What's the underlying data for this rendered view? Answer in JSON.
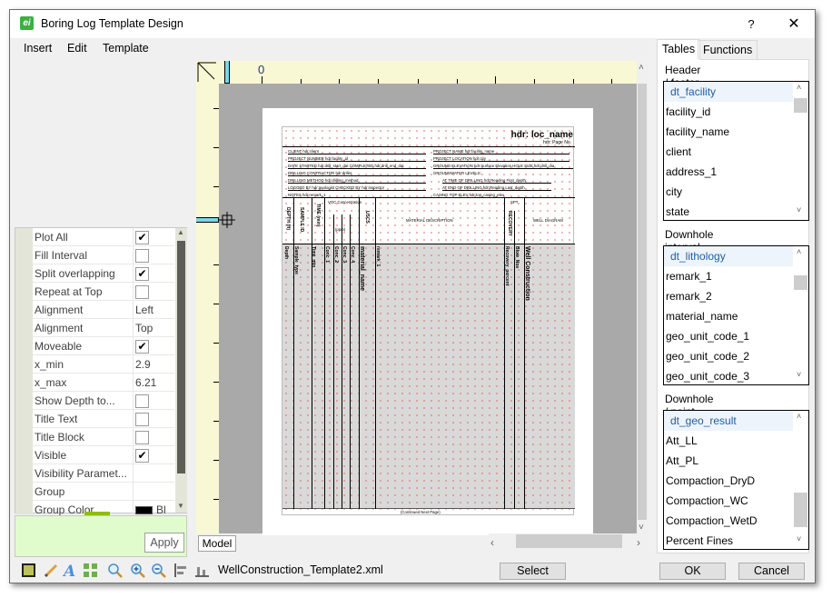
{
  "window": {
    "title": "Boring Log Template Design",
    "help_label": "?",
    "close_label": "✕",
    "app_icon_glyph": "ei"
  },
  "menu": {
    "items": [
      "Insert",
      "Edit",
      "Template"
    ]
  },
  "canvas": {
    "ruler_zero_label": "0",
    "model_tab_label": "Model",
    "template": {
      "header_title": "hdr: loc_name",
      "header_page": "hdr: Page No.",
      "info_left": [
        "CLIENT hdr:client",
        "PROJECT NUMBER hdr:facility_id",
        "DATE STARTED hdr:drill_start_dat  COMPLETED hdr:drill_end_dat",
        "DRILLING CONTRACTOR hdr:driller",
        "DRILLING METHOD hdr:drilling_method",
        "LOGGED BY hdr:geologist   CHECKED BY hdr:inspector",
        "NOTES hdr:remark_1"
      ],
      "info_right": [
        "PROJECT NAME hdr:facility_name",
        "PROJECT LOCATION hdr:city",
        "GROUND ELEVATION hdr:Surface Elevation  HOLE SIZE hdr:drill_dia",
        "GROUNDWATER LEVELS:",
        "AT TIME OF DRILLING hdr:Reading First_depth",
        "AT END OF DRILLING hdr:Reading Last_depth",
        "CASING TOP ELEV hdr:top_casing_elev"
      ],
      "column_headers": [
        "DEPTH (ft)",
        "SAMPLE ID",
        "TIME (min)",
        "VOC Concentration",
        "(ppm)",
        "USCS",
        "MATERIAL DESCRIPTION",
        "SPT",
        "RECOVERY",
        "WELL DIAGRAM"
      ],
      "column_fields": [
        "Depth",
        "Sample_type",
        "Time_min",
        "Conc_1",
        "Conc_2",
        "Conc_3",
        "Conc_4",
        "material_name",
        "remark_1",
        "Recovery_percent",
        "Blow_Nos",
        "Well Construction"
      ],
      "footer": "(Continued Next Page)"
    }
  },
  "properties": {
    "rows": [
      {
        "name": "Plot All",
        "type": "checkbox",
        "checked": true
      },
      {
        "name": "Fill Interval",
        "type": "checkbox",
        "checked": false
      },
      {
        "name": "Split overlapping",
        "type": "checkbox",
        "checked": true
      },
      {
        "name": "Repeat at Top",
        "type": "checkbox",
        "checked": false
      },
      {
        "name": "Alignment",
        "type": "text",
        "value": "Left"
      },
      {
        "name": "Alignment",
        "type": "text",
        "value": "Top"
      },
      {
        "name": "Moveable",
        "type": "checkbox",
        "checked": true
      },
      {
        "name": "x_min",
        "type": "text",
        "value": "2.9"
      },
      {
        "name": "x_max",
        "type": "text",
        "value": "6.21"
      },
      {
        "name": "Show  Depth  to...",
        "type": "checkbox",
        "checked": false
      },
      {
        "name": "Title Text",
        "type": "checkbox",
        "checked": false
      },
      {
        "name": "Title Block",
        "type": "checkbox",
        "checked": false
      },
      {
        "name": "Visible",
        "type": "checkbox",
        "checked": true
      },
      {
        "name": "Visibility  Paramet...",
        "type": "text",
        "value": ""
      },
      {
        "name": "Group",
        "type": "text",
        "value": ""
      },
      {
        "name": "Group Color",
        "type": "color",
        "value": "Bl",
        "color": "#000000"
      }
    ],
    "apply_label": "Apply"
  },
  "toolbar": {
    "icons": [
      "select-rectangle-icon",
      "pencil-icon",
      "text-style-icon",
      "grid-icon",
      "zoom-icon",
      "zoom-in-icon",
      "zoom-out-icon",
      "align-left-icon",
      "align-bottom-icon"
    ],
    "file_name": "WellConstruction_Template2.xml",
    "select_label": "Select"
  },
  "right_panel": {
    "tabs": [
      "Tables",
      "Functions"
    ],
    "active_tab": "Tables",
    "sections": [
      {
        "label": "Header / footer data",
        "table": "dt_facility",
        "fields": [
          "facility_id",
          "facility_name",
          "client",
          "address_1",
          "city",
          "state"
        ]
      },
      {
        "label": "Downhole interval data",
        "table": "dt_lithology",
        "fields": [
          "remark_1",
          "remark_2",
          "material_name",
          "geo_unit_code_1",
          "geo_unit_code_2",
          "geo_unit_code_3"
        ]
      },
      {
        "label": "Downhole / point data",
        "table": "dt_geo_result",
        "fields": [
          "Att_LL",
          "Att_PL",
          "Compaction_DryD",
          "Compaction_WC",
          "Compaction_WetD",
          "Percent Fines"
        ]
      }
    ]
  },
  "buttons": {
    "ok_label": "OK",
    "cancel_label": "Cancel"
  }
}
